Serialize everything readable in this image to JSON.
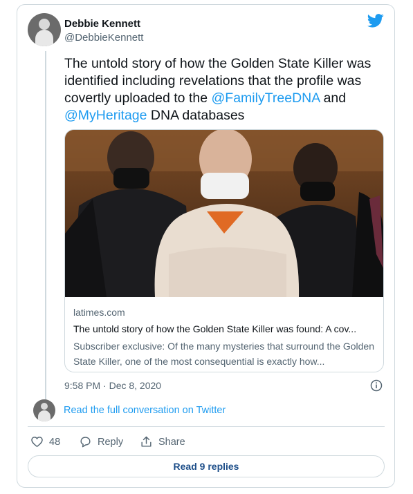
{
  "author": {
    "name": "Debbie Kennett",
    "handle": "@DebbieKennett"
  },
  "tweet": {
    "text_part1": "The untold story of how the Golden State Killer was identified including revelations that the profile was covertly uploaded to the ",
    "mention1": "@FamilyTreeDNA",
    "text_part2": " and ",
    "mention2": "@MyHeritage",
    "text_part3": " DNA databases"
  },
  "link_card": {
    "domain": "latimes.com",
    "title": "The untold story of how the Golden State Killer was found: A cov...",
    "description": "Subscriber exclusive: Of the many mysteries that surround the Golden State Killer, one of the most consequential is exactly how..."
  },
  "timestamp": "9:58 PM · Dec 8, 2020",
  "read_conversation": "Read the full conversation on Twitter",
  "actions": {
    "like_count": "48",
    "reply_label": "Reply",
    "share_label": "Share"
  },
  "read_replies": "Read 9 replies",
  "colors": {
    "accent": "#1d9bf0",
    "secondary_text": "#536471",
    "border": "#cfd9de"
  }
}
